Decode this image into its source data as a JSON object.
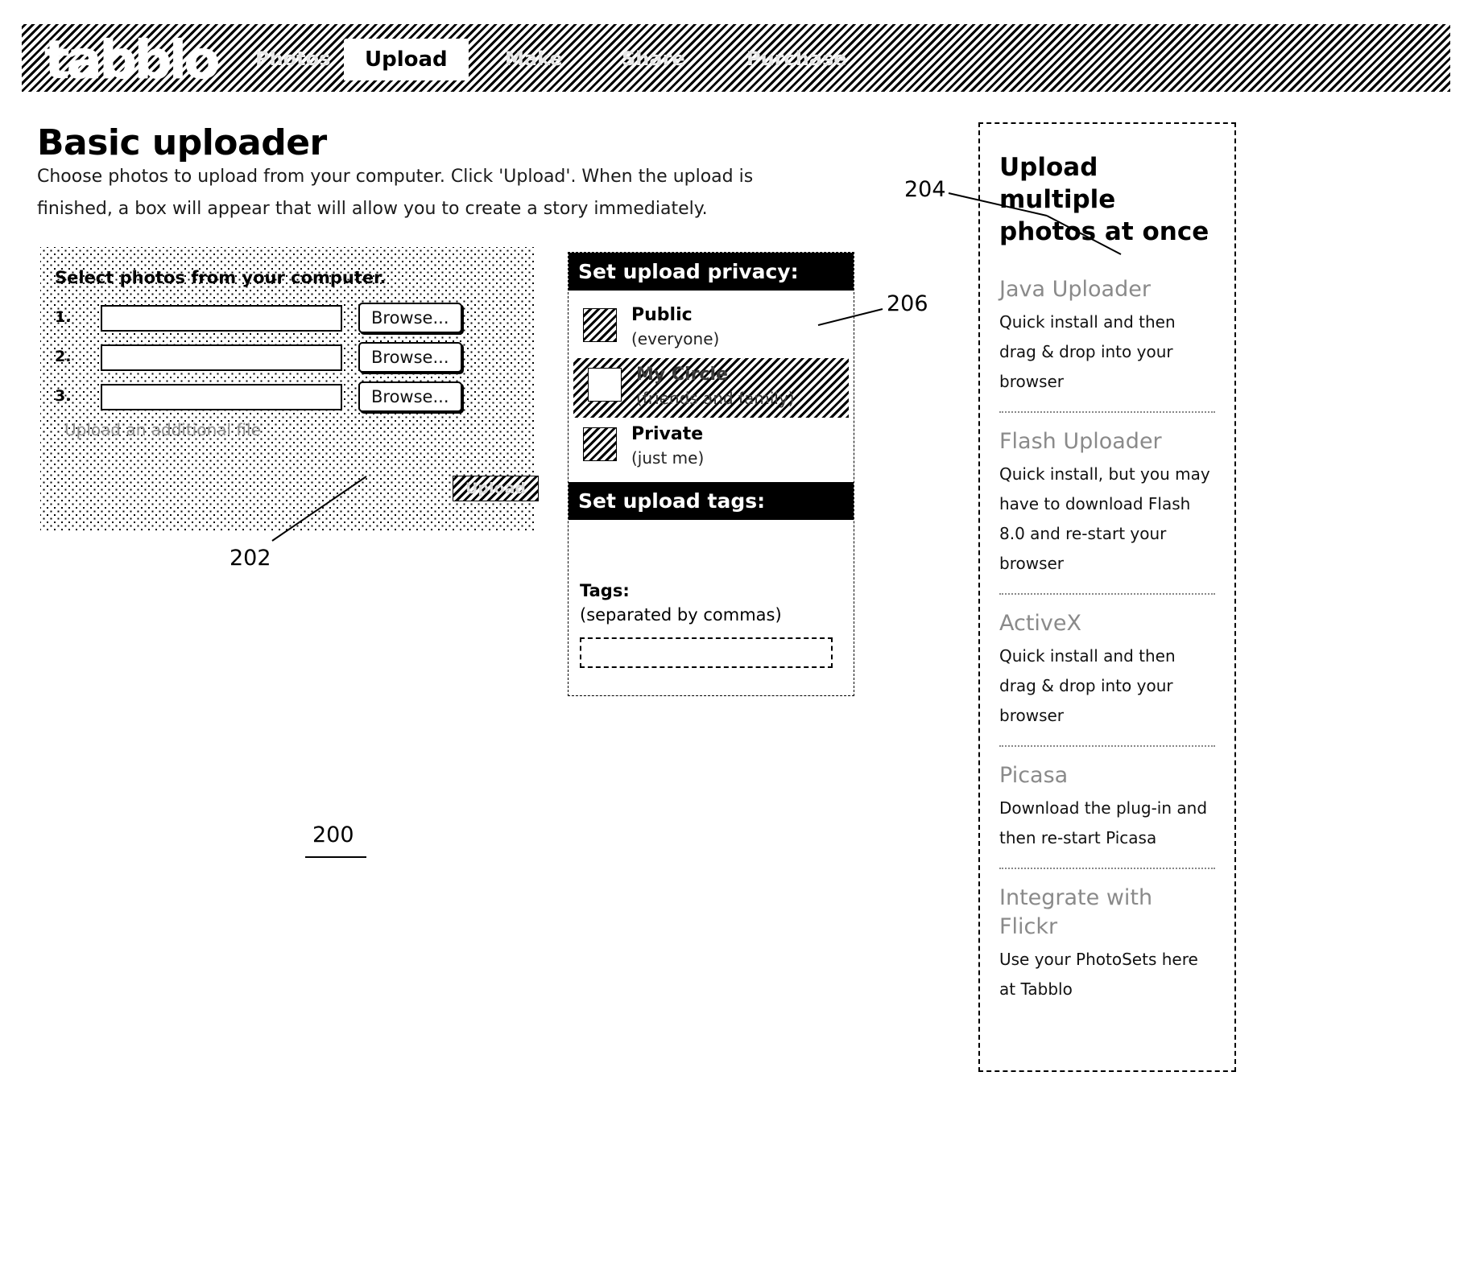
{
  "nav": {
    "logo": "tabblo",
    "items": [
      {
        "label": "Photos",
        "active": false
      },
      {
        "label": "Upload",
        "active": true
      },
      {
        "label": "Make",
        "active": false
      },
      {
        "label": "Share",
        "active": false
      },
      {
        "label": "Purchase",
        "active": false
      }
    ]
  },
  "page": {
    "title": "Basic uploader",
    "description": "Choose photos to upload from your computer. Click 'Upload'. When the upload is finished, a box will appear that will allow you to create a story immediately."
  },
  "uploader": {
    "title": "Select photos from your computer.",
    "rows": [
      {
        "number": "1.",
        "value": "",
        "browse_label": "Browse..."
      },
      {
        "number": "2.",
        "value": "",
        "browse_label": "Browse..."
      },
      {
        "number": "3.",
        "value": "",
        "browse_label": "Browse..."
      }
    ],
    "add_file_link": "Upload an additional file",
    "upload_button": "Upload"
  },
  "privacy": {
    "header": "Set upload privacy:",
    "options": [
      {
        "name": "Public",
        "sub": "(everyone)",
        "icon": "globe-icon",
        "selected": false
      },
      {
        "name": "My Circle",
        "sub": "(friends and family)",
        "icon": "people-icon",
        "selected": true
      },
      {
        "name": "Private",
        "sub": "(just me)",
        "icon": "lock-icon",
        "selected": false
      }
    ]
  },
  "tags": {
    "header": "Set upload tags:",
    "label": "Tags:",
    "hint": "(separated by commas)",
    "value": "",
    "placeholder": ""
  },
  "sidebar": {
    "title": "Upload multiple photos at once",
    "items": [
      {
        "head": "Java Uploader",
        "body": "Quick install and then drag & drop into your browser"
      },
      {
        "head": "Flash Uploader",
        "body": "Quick install, but you may have to download Flash 8.0 and re-start your browser"
      },
      {
        "head": "ActiveX",
        "body": "Quick install and then drag & drop into your browser"
      },
      {
        "head": "Picasa",
        "body": "Download the plug-in and then re-start Picasa"
      },
      {
        "head": "Integrate with Flickr",
        "body": "Use your PhotoSets here at Tabblo"
      }
    ]
  },
  "reference_numerals": {
    "fig": "200",
    "uploader": "202",
    "sidebar": "204",
    "privacy": "206"
  }
}
